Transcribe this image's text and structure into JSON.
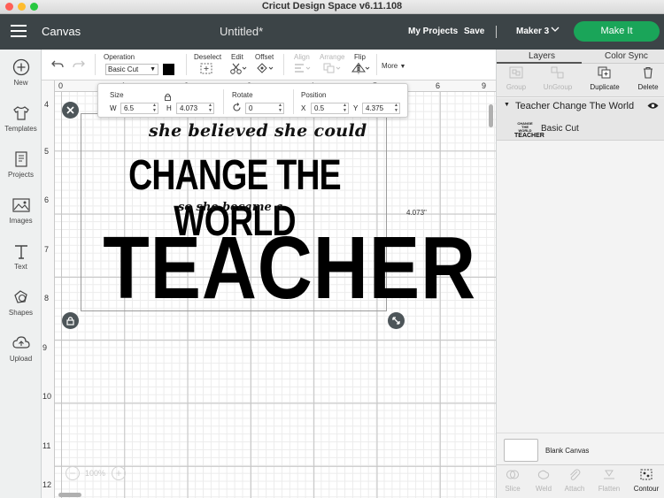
{
  "window": {
    "app_title": "Cricut Design Space  v6.11.108"
  },
  "header": {
    "screen": "Canvas",
    "document_title": "Untitled*",
    "my_projects": "My Projects",
    "save": "Save",
    "machine": "Maker 3",
    "make_it": "Make It",
    "brand_color": "#1aa559",
    "bar_color": "#3c4447"
  },
  "sidebar": {
    "items": [
      {
        "label": "New",
        "icon": "plus-circle-icon"
      },
      {
        "label": "Templates",
        "icon": "tshirt-icon"
      },
      {
        "label": "Projects",
        "icon": "projects-icon"
      },
      {
        "label": "Images",
        "icon": "image-icon"
      },
      {
        "label": "Text",
        "icon": "text-icon"
      },
      {
        "label": "Shapes",
        "icon": "shapes-icon"
      },
      {
        "label": "Upload",
        "icon": "upload-cloud-icon"
      }
    ]
  },
  "toolbar": {
    "operation_label": "Operation",
    "operation_value": "Basic Cut",
    "operation_color": "#000000",
    "deselect": "Deselect",
    "edit": "Edit",
    "offset": "Offset",
    "align": "Align",
    "arrange": "Arrange",
    "flip": "Flip",
    "more": "More"
  },
  "size_panel": {
    "size_label": "Size",
    "w_label": "W",
    "w_value": "6.5",
    "h_label": "H",
    "h_value": "4.073",
    "rotate_label": "Rotate",
    "rotate_value": "0",
    "position_label": "Position",
    "x_label": "X",
    "x_value": "0.5",
    "y_label": "Y",
    "y_value": "4.375"
  },
  "rulers": {
    "top": [
      "0",
      "1",
      "2",
      "3",
      "4",
      "5",
      "6",
      "7",
      "8",
      "9"
    ],
    "left": [
      "4",
      "5",
      "6",
      "7",
      "8",
      "9",
      "10",
      "11",
      "12"
    ]
  },
  "design": {
    "line1": "she believed she could",
    "line2": "CHANGE THE WORLD",
    "line3": "so she became a",
    "line4": "TEACHER",
    "height_readout": "4.073\""
  },
  "zoom": {
    "value": "100%",
    "minus": "−",
    "plus": "+"
  },
  "layers_panel": {
    "tabs": [
      "Layers",
      "Color Sync"
    ],
    "actions": [
      {
        "label": "Group",
        "enabled": false
      },
      {
        "label": "UnGroup",
        "enabled": false
      },
      {
        "label": "Duplicate",
        "enabled": true
      },
      {
        "label": "Delete",
        "enabled": true
      }
    ],
    "group_name": "Teacher Change The World",
    "layer_name": "Basic Cut",
    "thumb_line1": "CHANGE THE WORLD",
    "thumb_line2": "TEACHER",
    "blank_canvas": "Blank Canvas",
    "bottom_actions": [
      {
        "label": "Slice",
        "enabled": false
      },
      {
        "label": "Weld",
        "enabled": false
      },
      {
        "label": "Attach",
        "enabled": false
      },
      {
        "label": "Flatten",
        "enabled": false
      },
      {
        "label": "Contour",
        "enabled": true
      }
    ]
  }
}
